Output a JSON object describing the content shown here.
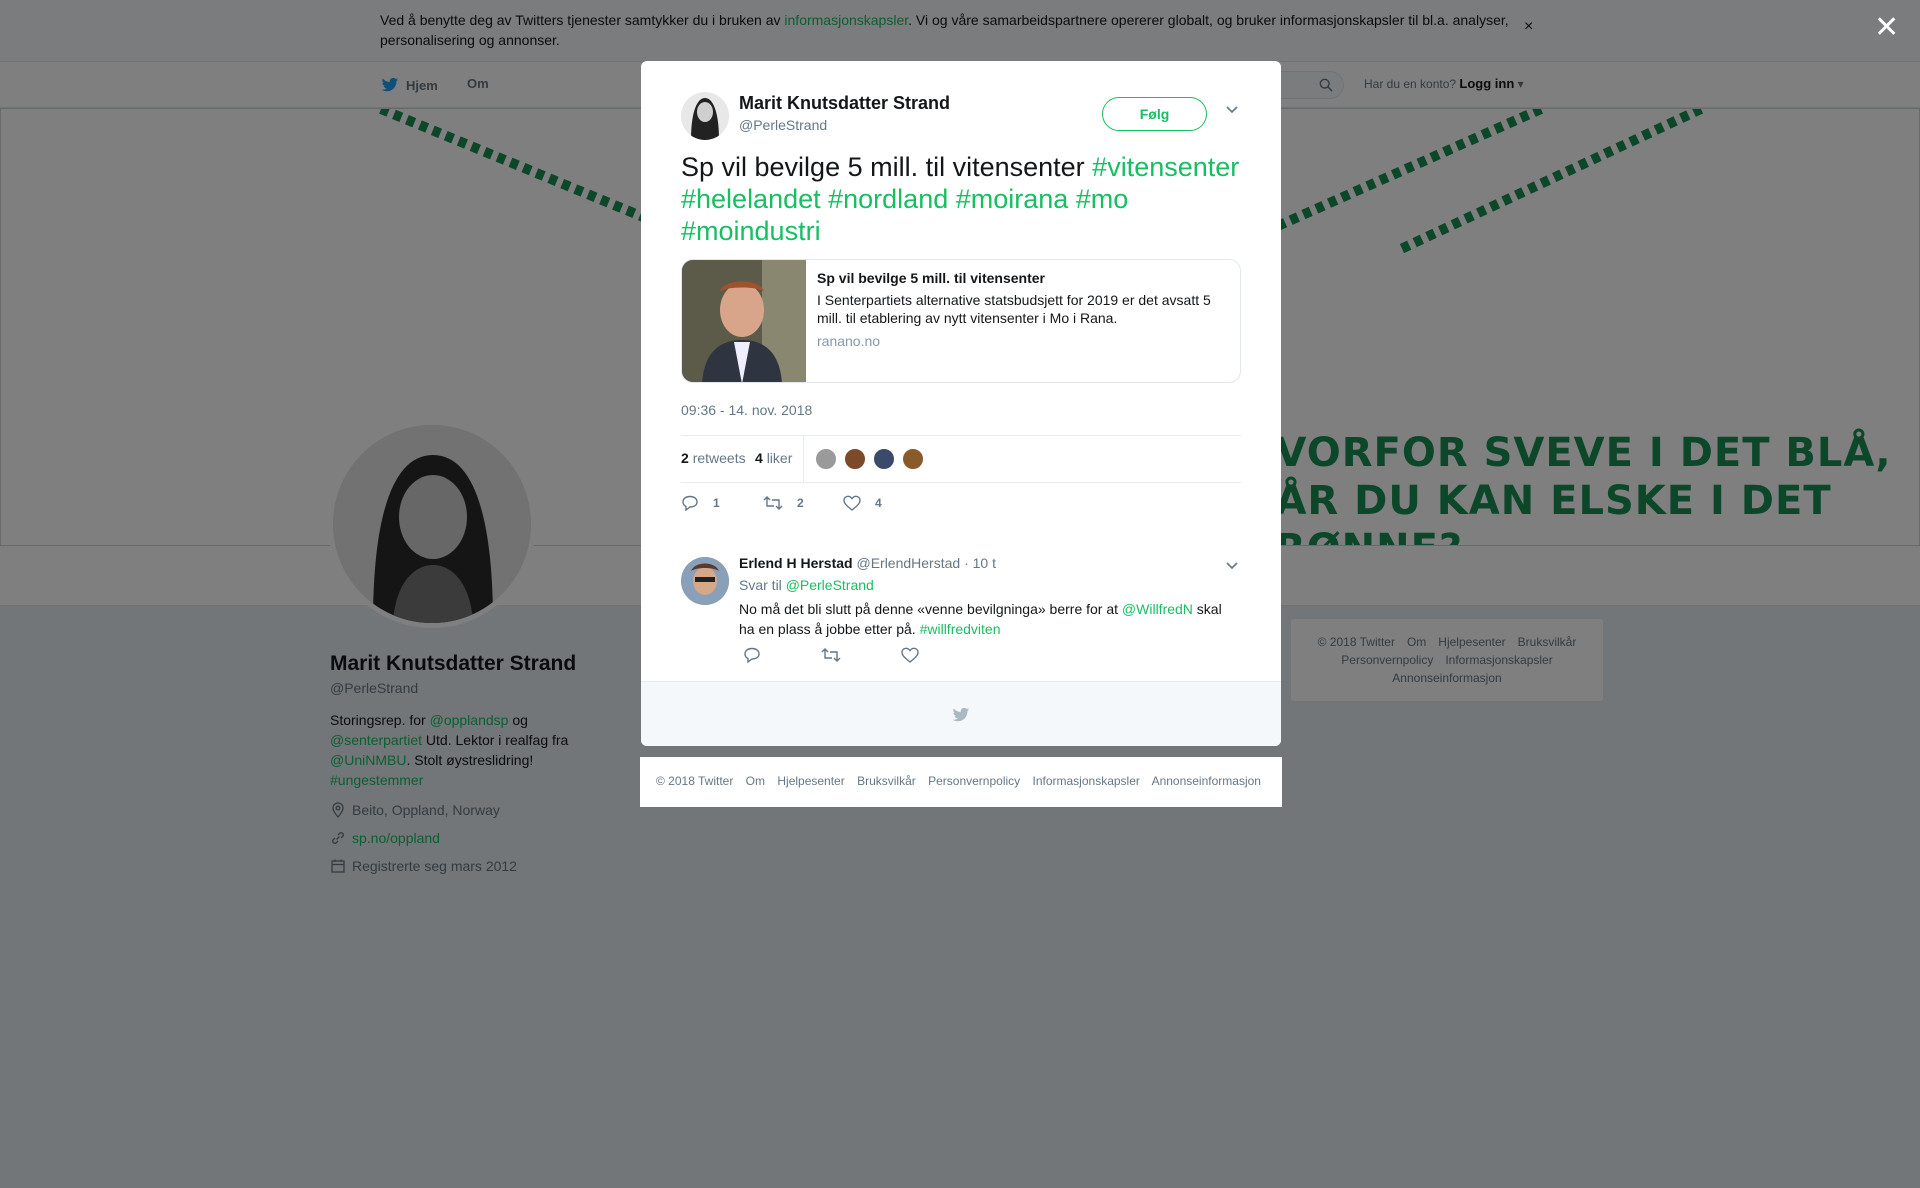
{
  "cookie_banner": {
    "text_before": "Ved å benytte deg av Twitters tjenester samtykker du i bruken av ",
    "link": "informasjonskapsler",
    "text_after": ". Vi og våre samarbeidspartnere opererer globalt, og bruker informasjonskapsler til bl.a. analyser, personalisering og annonser.",
    "close": "×"
  },
  "nav": {
    "home": "Hjem",
    "about": "Om",
    "login_prompt": "Har du en konto?",
    "login": "Logg inn"
  },
  "banner": {
    "line1": "HVORFOR SVEVE I DET BLÅ,",
    "line2": "NÅR DU KAN ELSKE I DET GRØNNE?"
  },
  "profile": {
    "name": "Marit Knutsdatter Strand",
    "handle": "@PerleStrand",
    "bio": {
      "p1": "Storingsrep. for ",
      "m1": "@opplandsp",
      "p2": " og ",
      "m2": "@senterpartiet",
      "p3": " Utd. Lektor i realfag fra ",
      "m3": "@UniNMBU",
      "p4": ". Stolt øystreslidring! ",
      "h1": "#ungestemmer"
    },
    "location": "Beito, Oppland, Norway",
    "website": "sp.no/oppland",
    "joined": "Registrerte seg mars 2012"
  },
  "side_footer": [
    "© 2018 Twitter",
    "Om",
    "Hjelpesenter",
    "Bruksvilkår",
    "Personvernpolicy",
    "Informasjonskapsler",
    "Annonseinformasjon"
  ],
  "overlay_close": "✕",
  "tweet": {
    "author_name": "Marit Knutsdatter Strand",
    "author_handle": "@PerleStrand",
    "follow": "Følg",
    "text": "Sp vil bevilge 5 mill. til vitensenter ",
    "hashtags": "#vitensenter #helelandet #nordland #moirana #mo #moindustri",
    "card": {
      "title": "Sp vil bevilge 5 mill. til vitensenter",
      "description": "I Senterpartiets alternative statsbudsjett for 2019 er det avsatt 5 mill. til etablering av nytt vitensenter i Mo i Rana.",
      "domain": "ranano.no"
    },
    "timestamp": "09:36 - 14. nov. 2018",
    "retweets_count": "2",
    "retweets_label": "retweets",
    "likes_count": "4",
    "likes_label": "liker",
    "actions": {
      "replies": "1",
      "retweets": "2",
      "likes": "4"
    }
  },
  "reply": {
    "name": "Erlend H Herstad",
    "handle": "@ErlendHerstad",
    "time": "· 10 t",
    "reply_to_label": "Svar til ",
    "reply_to": "@PerleStrand",
    "text_before": "No må det bli slutt på denne «venne bevilgninga» berre for at ",
    "mention": "@WillfredN",
    "text_after": " skal ha en plass å jobbe etter på. ",
    "hashtag": "#willfredviten"
  },
  "modal_footer": [
    "© 2018 Twitter",
    "Om",
    "Hjelpesenter",
    "Bruksvilkår",
    "Personvernpolicy",
    "Informasjonskapsler",
    "Annonseinformasjon"
  ],
  "colors": {
    "accent": "#17bf63",
    "overlay": "rgba(0,0,0,0.5)",
    "text_secondary": "#657786"
  }
}
